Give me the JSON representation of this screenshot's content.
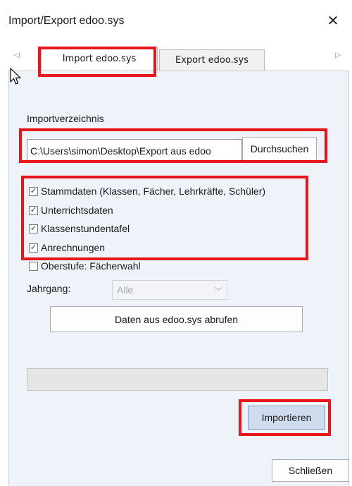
{
  "window": {
    "title": "Import/Export edoo.sys",
    "close_label": "✕"
  },
  "tabs": [
    {
      "label": "Import edoo.sys",
      "active": true
    },
    {
      "label": "Export edoo.sys",
      "active": false
    }
  ],
  "tab_nav": {
    "left": "◁",
    "right": "▷"
  },
  "import": {
    "dir_label": "Importverzeichnis",
    "dir_value": "C:\\Users\\simon\\Desktop\\Export aus edoo",
    "browse_label": "Durchsuchen",
    "options": [
      {
        "label": "Stammdaten (Klassen, Fächer, Lehrkräfte, Schüler)",
        "checked": true
      },
      {
        "label": "Unterrichtsdaten",
        "checked": true
      },
      {
        "label": "Klassenstundentafel",
        "checked": true
      },
      {
        "label": "Anrechnungen",
        "checked": true
      },
      {
        "label": "Oberstufe: Fächerwahl",
        "checked": false
      }
    ],
    "jahrgang_label": "Jahrgang:",
    "jahrgang_value": "Alle",
    "fetch_label": "Daten aus edoo.sys abrufen",
    "progress": 0,
    "import_label": "Importieren"
  },
  "footer": {
    "close_label": "Schließen"
  },
  "colors": {
    "highlight": "#e8151a",
    "panel": "#eef3fa",
    "primary_button": "#cfdcee"
  },
  "icons": {
    "check": "✓",
    "dropdown": "﹀"
  }
}
